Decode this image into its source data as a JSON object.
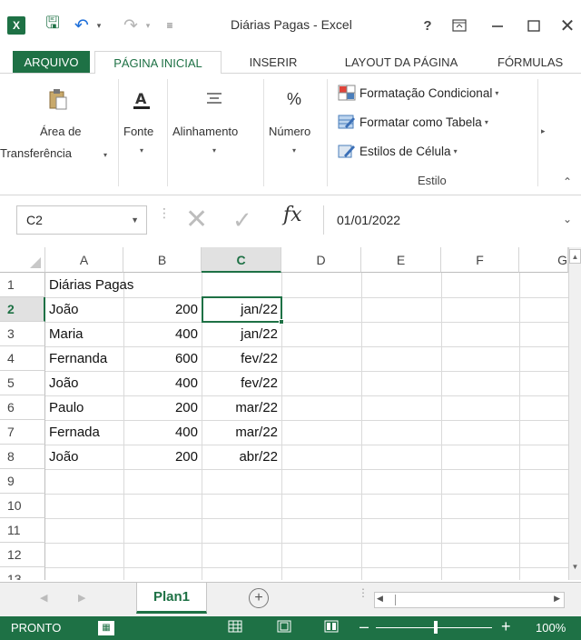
{
  "window": {
    "title": "Diárias Pagas - Excel",
    "help": "?",
    "logo": "X"
  },
  "tabs": [
    "ARQUIVO",
    "PÁGINA INICIAL",
    "INSERIR",
    "LAYOUT DA PÁGINA",
    "FÓRMULAS"
  ],
  "ribbon": {
    "clipboard_line1": "Área de",
    "clipboard_line2": "Transferência",
    "font_label": "Fonte",
    "alignment_label": "Alinhamento",
    "number_label": "Número",
    "number_icon": "%",
    "style_items": [
      "Formatação Condicional",
      "Formatar como Tabela",
      "Estilos de Célula"
    ],
    "style_group": "Estilo"
  },
  "formula_bar": {
    "name_box": "C2",
    "fx": "fx",
    "value": "01/01/2022"
  },
  "grid": {
    "columns": [
      "A",
      "B",
      "C",
      "D",
      "E",
      "F",
      "G"
    ],
    "selected_column": "C",
    "rows": [
      "1",
      "2",
      "3",
      "4",
      "5",
      "6",
      "7",
      "8",
      "9",
      "10",
      "11",
      "12",
      "13"
    ],
    "selected_row": "2",
    "title": "Diárias Pagas",
    "data": [
      {
        "name": "João",
        "value": "200",
        "month": "jan/22"
      },
      {
        "name": "Maria",
        "value": "400",
        "month": "jan/22"
      },
      {
        "name": "Fernanda",
        "value": "600",
        "month": "fev/22"
      },
      {
        "name": "João",
        "value": "400",
        "month": "fev/22"
      },
      {
        "name": "Paulo",
        "value": "200",
        "month": "mar/22"
      },
      {
        "name": "Fernada",
        "value": "400",
        "month": "mar/22"
      },
      {
        "name": "João",
        "value": "200",
        "month": "abr/22"
      }
    ]
  },
  "sheets": {
    "active": "Plan1",
    "add": "+"
  },
  "status": {
    "text": "PRONTO",
    "zoom": "100%"
  },
  "colors": {
    "excel_green": "#1e7145",
    "header_selected": "#e1e1e1"
  }
}
